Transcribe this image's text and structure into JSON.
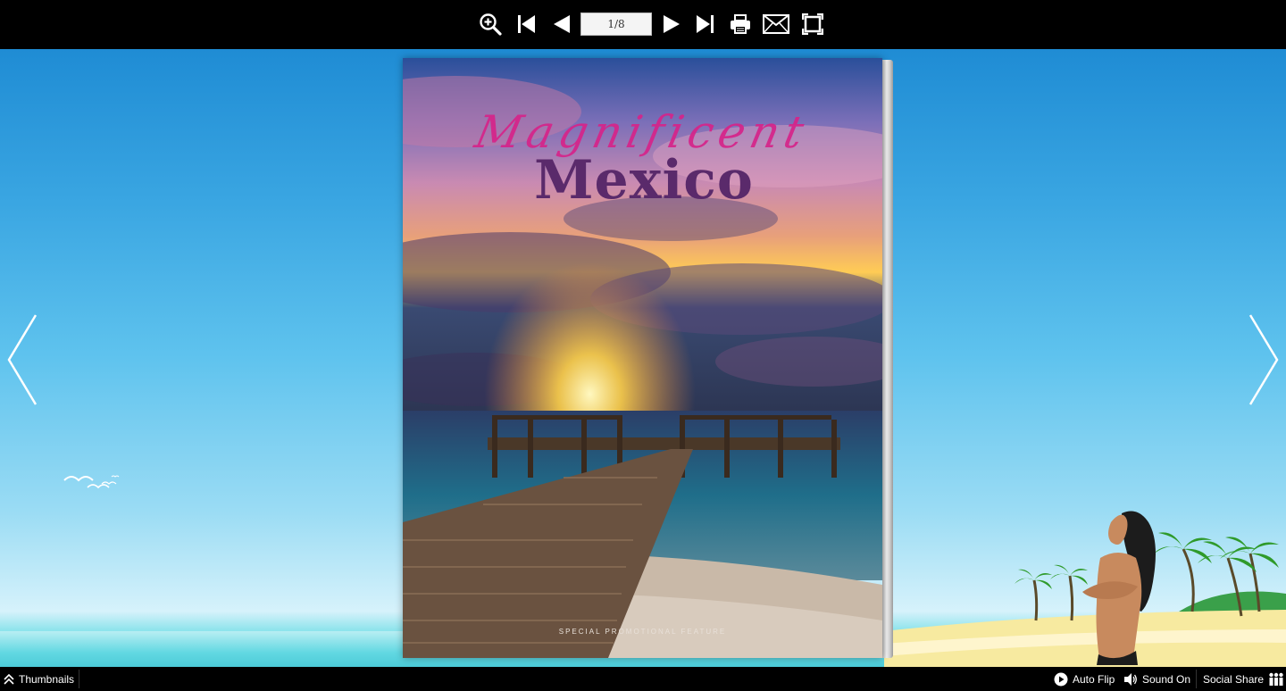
{
  "toolbar": {
    "page_indicator": "1/8",
    "icons": [
      "zoom-in-icon",
      "first-page-icon",
      "previous-page-icon",
      "next-page-icon",
      "last-page-icon",
      "print-icon",
      "email-icon",
      "fullscreen-icon"
    ]
  },
  "book": {
    "cover_script_title": "Magnificent",
    "cover_title": "Mexico",
    "cover_feature": "SPECIAL PROMOTIONAL FEATURE"
  },
  "bottombar": {
    "thumbnails_label": "Thumbnails",
    "autoflip_label": "Auto Flip",
    "sound_label": "Sound On",
    "social_label": "Social Share"
  },
  "colors": {
    "toolbar_bg": "#000000",
    "sky_top": "#1f8cd4",
    "sky_bottom": "#d6f2fb",
    "title_purple": "#5a2a6b",
    "script_pink": "#d6248a"
  }
}
